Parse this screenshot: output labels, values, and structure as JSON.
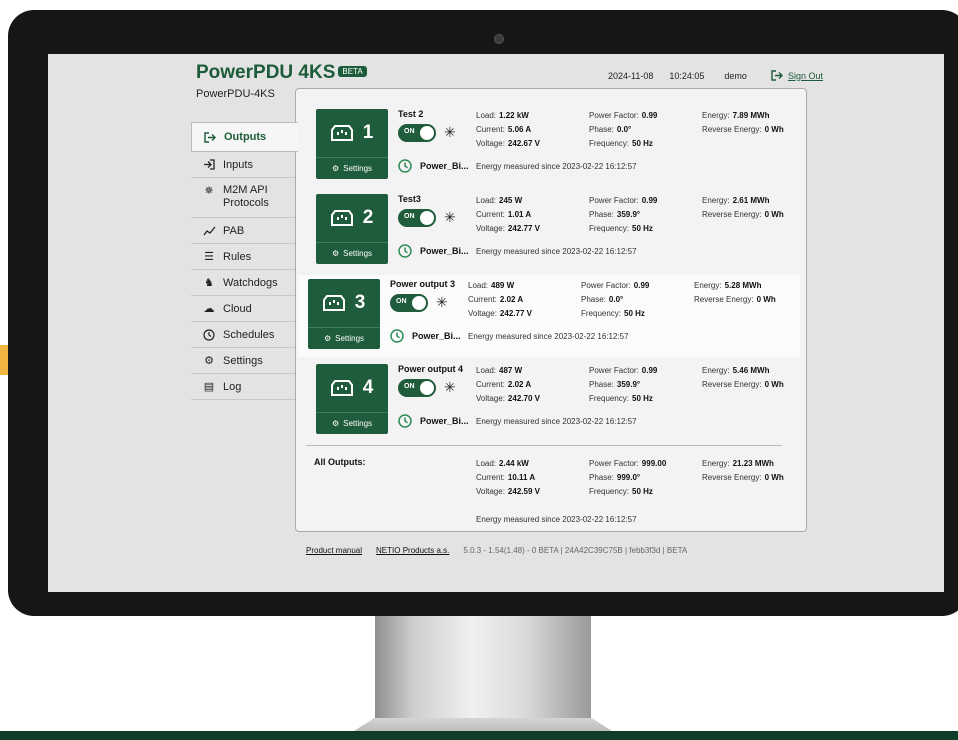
{
  "header": {
    "brand": "PowerPDU 4KS",
    "beta": "BETA",
    "device_name": "PowerPDU-4KS",
    "date": "2024-11-08",
    "time": "10:24:05",
    "user": "demo",
    "sign_out": "Sign Out"
  },
  "sidebar": {
    "items": [
      {
        "label": "Outputs",
        "icon": "arrow-right-box-icon"
      },
      {
        "label": "Inputs",
        "icon": "arrow-in-box-icon"
      },
      {
        "label": "M2M API Protocols",
        "icon": "plug-icon"
      },
      {
        "label": "PAB",
        "icon": "trend-icon"
      },
      {
        "label": "Rules",
        "icon": "rules-icon"
      },
      {
        "label": "Watchdogs",
        "icon": "dog-icon"
      },
      {
        "label": "Cloud",
        "icon": "cloud-icon"
      },
      {
        "label": "Schedules",
        "icon": "clock-icon"
      },
      {
        "label": "Settings",
        "icon": "gear-icon"
      },
      {
        "label": "Log",
        "icon": "log-icon"
      }
    ]
  },
  "labels": {
    "settings": "Settings",
    "on": "ON",
    "schedule": "Power_Bi...",
    "load": "Load:",
    "current": "Current:",
    "voltage": "Voltage:",
    "power_factor": "Power Factor:",
    "phase": "Phase:",
    "frequency": "Frequency:",
    "energy": "Energy:",
    "reverse_energy": "Reverse Energy:",
    "energy_since": "Energy measured since 2023-02-22 16:12:57"
  },
  "outputs": [
    {
      "num": "1",
      "name": "Test 2",
      "load": "1.22 kW",
      "current": "5.06 A",
      "voltage": "242.67 V",
      "pf": "0.99",
      "phase": "0.0°",
      "freq": "50 Hz",
      "energy": "7.89 MWh",
      "reverse": "0 Wh"
    },
    {
      "num": "2",
      "name": "Test3",
      "load": "245 W",
      "current": "1.01 A",
      "voltage": "242.77 V",
      "pf": "0.99",
      "phase": "359.9°",
      "freq": "50 Hz",
      "energy": "2.61 MWh",
      "reverse": "0 Wh"
    },
    {
      "num": "3",
      "name": "Power output 3",
      "load": "489 W",
      "current": "2.02 A",
      "voltage": "242.77 V",
      "pf": "0.99",
      "phase": "0.0°",
      "freq": "50 Hz",
      "energy": "5.28 MWh",
      "reverse": "0 Wh"
    },
    {
      "num": "4",
      "name": "Power output 4",
      "load": "487 W",
      "current": "2.02 A",
      "voltage": "242.70 V",
      "pf": "0.99",
      "phase": "359.9°",
      "freq": "50 Hz",
      "energy": "5.46 MWh",
      "reverse": "0 Wh"
    }
  ],
  "all_outputs": {
    "label": "All Outputs:",
    "load": "2.44 kW",
    "current": "10.11 A",
    "voltage": "242.59 V",
    "pf": "999.00",
    "phase": "999.0°",
    "freq": "50 Hz",
    "energy": "21.23 MWh",
    "reverse": "0 Wh"
  },
  "footer": {
    "manual": "Product manual",
    "company": "NETIO Products a.s.",
    "version": "5.0.3 - 1.54(1.48) - 0 BETA | 24A42C39C75B | febb3f3d | BETA"
  },
  "colors": {
    "brand": "#1c5c3a",
    "tile": "#1e5c3c"
  }
}
